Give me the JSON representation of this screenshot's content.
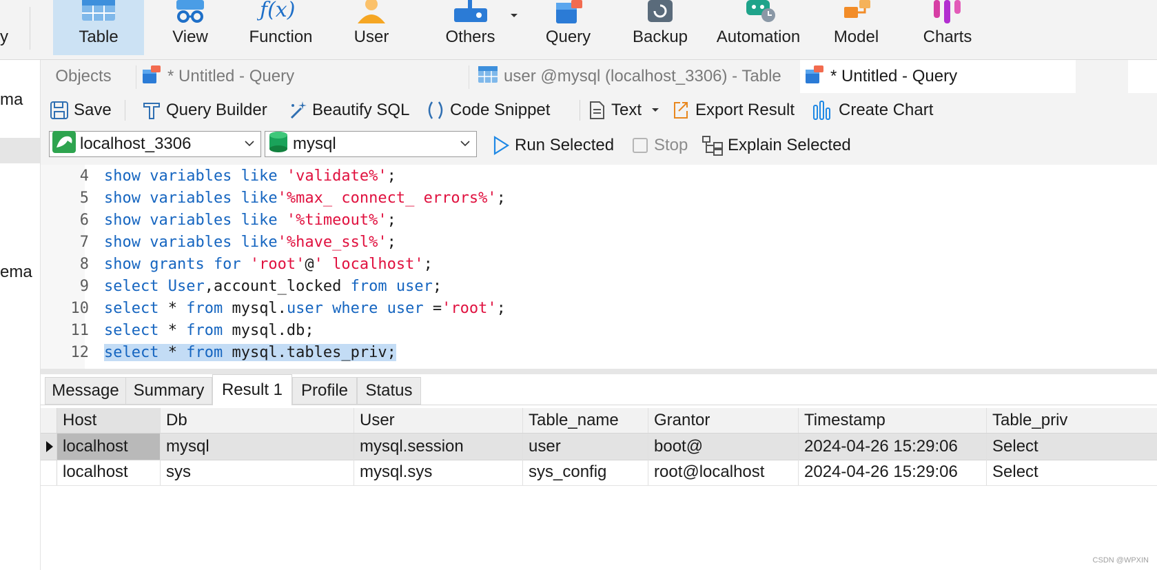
{
  "ribbon": {
    "items": [
      {
        "label": "Table",
        "icon": "table-icon",
        "active": true
      },
      {
        "label": "View",
        "icon": "view-icon"
      },
      {
        "label": "Function",
        "icon": "function-icon"
      },
      {
        "label": "User",
        "icon": "user-icon"
      },
      {
        "label": "Others",
        "icon": "others-icon"
      },
      {
        "label": "Query",
        "icon": "query-icon"
      },
      {
        "label": "Backup",
        "icon": "backup-icon"
      },
      {
        "label": "Automation",
        "icon": "automation-icon"
      },
      {
        "label": "Model",
        "icon": "model-icon"
      },
      {
        "label": "Charts",
        "icon": "charts-icon"
      }
    ]
  },
  "left_panel": {
    "item1": "ma",
    "item2": "ema"
  },
  "tabs": [
    {
      "label": "Objects",
      "active": false
    },
    {
      "label": "* Untitled - Query",
      "icon": "query-tab-icon",
      "active": false
    },
    {
      "label": "user @mysql (localhost_3306) - Table",
      "icon": "table-tab-icon",
      "active": false
    },
    {
      "label": "* Untitled - Query",
      "icon": "query-tab-icon",
      "active": true
    }
  ],
  "toolbar": {
    "save": "Save",
    "query_builder": "Query Builder",
    "beautify_sql": "Beautify SQL",
    "code_snippet": "Code Snippet",
    "text": "Text",
    "export_result": "Export Result",
    "create_chart": "Create Chart"
  },
  "connection_bar": {
    "connection": "localhost_3306",
    "database": "mysql",
    "run_selected": "Run Selected",
    "stop": "Stop",
    "explain_selected": "Explain Selected"
  },
  "editor": {
    "lines": [
      {
        "num": "4",
        "parts": [
          {
            "t": "show variables like ",
            "c": "kw"
          },
          {
            "t": "'validate%'",
            "c": "str"
          },
          {
            "t": ";",
            "c": ""
          }
        ]
      },
      {
        "num": "5",
        "parts": [
          {
            "t": "show variables like",
            "c": "kw"
          },
          {
            "t": "'%max_ connect_ errors%'",
            "c": "str"
          },
          {
            "t": ";",
            "c": ""
          }
        ]
      },
      {
        "num": "6",
        "parts": [
          {
            "t": "show variables like ",
            "c": "kw"
          },
          {
            "t": "'%timeout%'",
            "c": "str"
          },
          {
            "t": ";",
            "c": ""
          }
        ]
      },
      {
        "num": "7",
        "parts": [
          {
            "t": "show variables like",
            "c": "kw"
          },
          {
            "t": "'%have_ssl%'",
            "c": "str"
          },
          {
            "t": ";",
            "c": ""
          }
        ]
      },
      {
        "num": "8",
        "parts": [
          {
            "t": "show grants for ",
            "c": "kw"
          },
          {
            "t": "'root'",
            "c": "str"
          },
          {
            "t": "@",
            "c": ""
          },
          {
            "t": "' localhost'",
            "c": "str"
          },
          {
            "t": ";",
            "c": ""
          }
        ]
      },
      {
        "num": "9",
        "parts": [
          {
            "t": "select User",
            "c": "kw"
          },
          {
            "t": ",account_locked ",
            "c": ""
          },
          {
            "t": "from user",
            "c": "kw"
          },
          {
            "t": ";",
            "c": ""
          }
        ]
      },
      {
        "num": "10",
        "parts": [
          {
            "t": "select ",
            "c": "kw"
          },
          {
            "t": "* ",
            "c": ""
          },
          {
            "t": "from ",
            "c": "kw"
          },
          {
            "t": "mysql.",
            "c": ""
          },
          {
            "t": "user where user ",
            "c": "kw"
          },
          {
            "t": "=",
            "c": ""
          },
          {
            "t": "'root'",
            "c": "str"
          },
          {
            "t": ";",
            "c": ""
          }
        ]
      },
      {
        "num": "11",
        "parts": [
          {
            "t": "select ",
            "c": "kw"
          },
          {
            "t": "* ",
            "c": ""
          },
          {
            "t": "from ",
            "c": "kw"
          },
          {
            "t": "mysql.db;",
            "c": ""
          }
        ]
      },
      {
        "num": "12",
        "selected": true,
        "parts": [
          {
            "t": "select ",
            "c": "kw"
          },
          {
            "t": "* ",
            "c": ""
          },
          {
            "t": "from ",
            "c": "kw"
          },
          {
            "t": "mysql.tables_priv;",
            "c": ""
          }
        ]
      }
    ]
  },
  "result_tabs": [
    {
      "label": "Message",
      "active": false
    },
    {
      "label": "Summary",
      "active": false
    },
    {
      "label": "Result 1",
      "active": true
    },
    {
      "label": "Profile",
      "active": false
    },
    {
      "label": "Status",
      "active": false
    }
  ],
  "grid": {
    "columns": [
      "Host",
      "Db",
      "User",
      "Table_name",
      "Grantor",
      "Timestamp",
      "Table_priv"
    ],
    "rows": [
      [
        "localhost",
        "mysql",
        "mysql.session",
        "user",
        "boot@",
        "2024-04-26 15:29:06",
        "Select"
      ],
      [
        "localhost",
        "sys",
        "mysql.sys",
        "sys_config",
        "root@localhost",
        "2024-04-26 15:29:06",
        "Select"
      ]
    ]
  },
  "watermark": "CSDN @WPXIN",
  "colors": {
    "accent": "#1e88e5",
    "keyword": "#1565c0",
    "string": "#e0113f",
    "selection": "#c3dcf5",
    "ribbon_active": "#cce2f4"
  }
}
